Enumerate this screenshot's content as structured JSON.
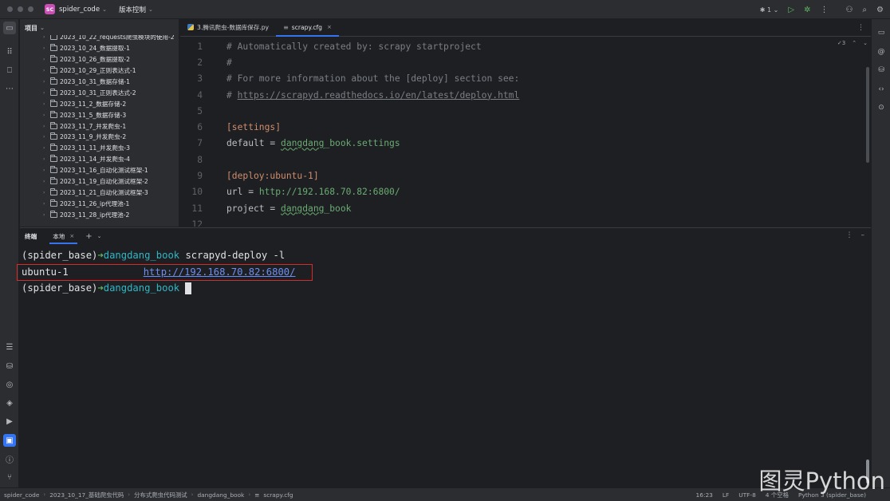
{
  "titlebar": {
    "project_badge": "SC",
    "project_name": "spider_code",
    "vcs_label": "版本控制",
    "run_config_count": "1"
  },
  "project_panel": {
    "title": "项目",
    "items": [
      "2023_10_22_requests爬虫模块的使用-2",
      "2023_10_24_数据提取-1",
      "2023_10_26_数据提取-2",
      "2023_10_29_正则表达式-1",
      "2023_10_31_数据存储-1",
      "2023_10_31_正则表达式-2",
      "2023_11_2_数据存储-2",
      "2023_11_5_数据存储-3",
      "2023_11_7_并发爬虫-1",
      "2023_11_9_并发爬虫-2",
      "2023_11_11_并发爬虫-3",
      "2023_11_14_并发爬虫-4",
      "2023_11_16_自动化测试框架-1",
      "2023_11_19_自动化测试框架-2",
      "2023_11_21_自动化测试框架-3",
      "2023_11_26_ip代理池-1",
      "2023_11_28_ip代理池-2"
    ]
  },
  "editor": {
    "tabs": [
      {
        "label": "3.腾讯爬虫-数据库保存.py"
      },
      {
        "label": "scrapy.cfg"
      }
    ],
    "inspection_count": "3",
    "lines": [
      {
        "n": "1",
        "type": "comment",
        "text": "# Automatically created by: scrapy startproject"
      },
      {
        "n": "2",
        "type": "comment",
        "text": "#"
      },
      {
        "n": "3",
        "type": "comment",
        "text": "# For more information about the [deploy] section see:"
      },
      {
        "n": "4",
        "type": "comment-link",
        "prefix": "# ",
        "text": "https://scrapyd.readthedocs.io/en/latest/deploy.html"
      },
      {
        "n": "5",
        "type": "blank",
        "text": ""
      },
      {
        "n": "6",
        "type": "section",
        "text": "[settings]"
      },
      {
        "n": "7",
        "type": "kv",
        "key": "default = ",
        "value": "dangdang_book.settings",
        "value_link": "dangdang",
        "value_rest": "_book.settings"
      },
      {
        "n": "8",
        "type": "blank",
        "text": ""
      },
      {
        "n": "9",
        "type": "section",
        "text": "[deploy:ubuntu-1]"
      },
      {
        "n": "10",
        "type": "kv-url",
        "key": "url = ",
        "value": "http://192.168.70.82:6800/"
      },
      {
        "n": "11",
        "type": "kv",
        "key": "project = ",
        "value": "dangdang_book",
        "value_link": "dangdang",
        "value_rest": "_book"
      },
      {
        "n": "12",
        "type": "blank",
        "text": ""
      }
    ]
  },
  "terminal": {
    "title": "终端",
    "tab": "本地",
    "lines": [
      {
        "env": "(spider_base)",
        "arrow": "➜",
        "dir": "dangdang_book",
        "cmd": " scrapyd-deploy -l"
      },
      {
        "target": "ubuntu-1",
        "url": "http://192.168.70.82:6800/"
      },
      {
        "env": "(spider_base)",
        "arrow": "➜",
        "dir": "dangdang_book",
        "cmd": " "
      }
    ]
  },
  "statusbar": {
    "breadcrumb": [
      "spider_code",
      "2023_10_17_基础爬虫代码",
      "分布式爬虫代码测试",
      "dangdang_book",
      "scrapy.cfg"
    ],
    "position": "16:23",
    "line_sep": "LF",
    "encoding": "UTF-8",
    "indent": "4 个空格",
    "interpreter": "Python 3 (spider_base)"
  },
  "watermark": "图灵Python",
  "colors": {
    "accent": "#3574f0",
    "highlight_box": "#d62b2b",
    "prompt_arrow": "#5fb85f",
    "prompt_dir": "#2fb7c6"
  }
}
